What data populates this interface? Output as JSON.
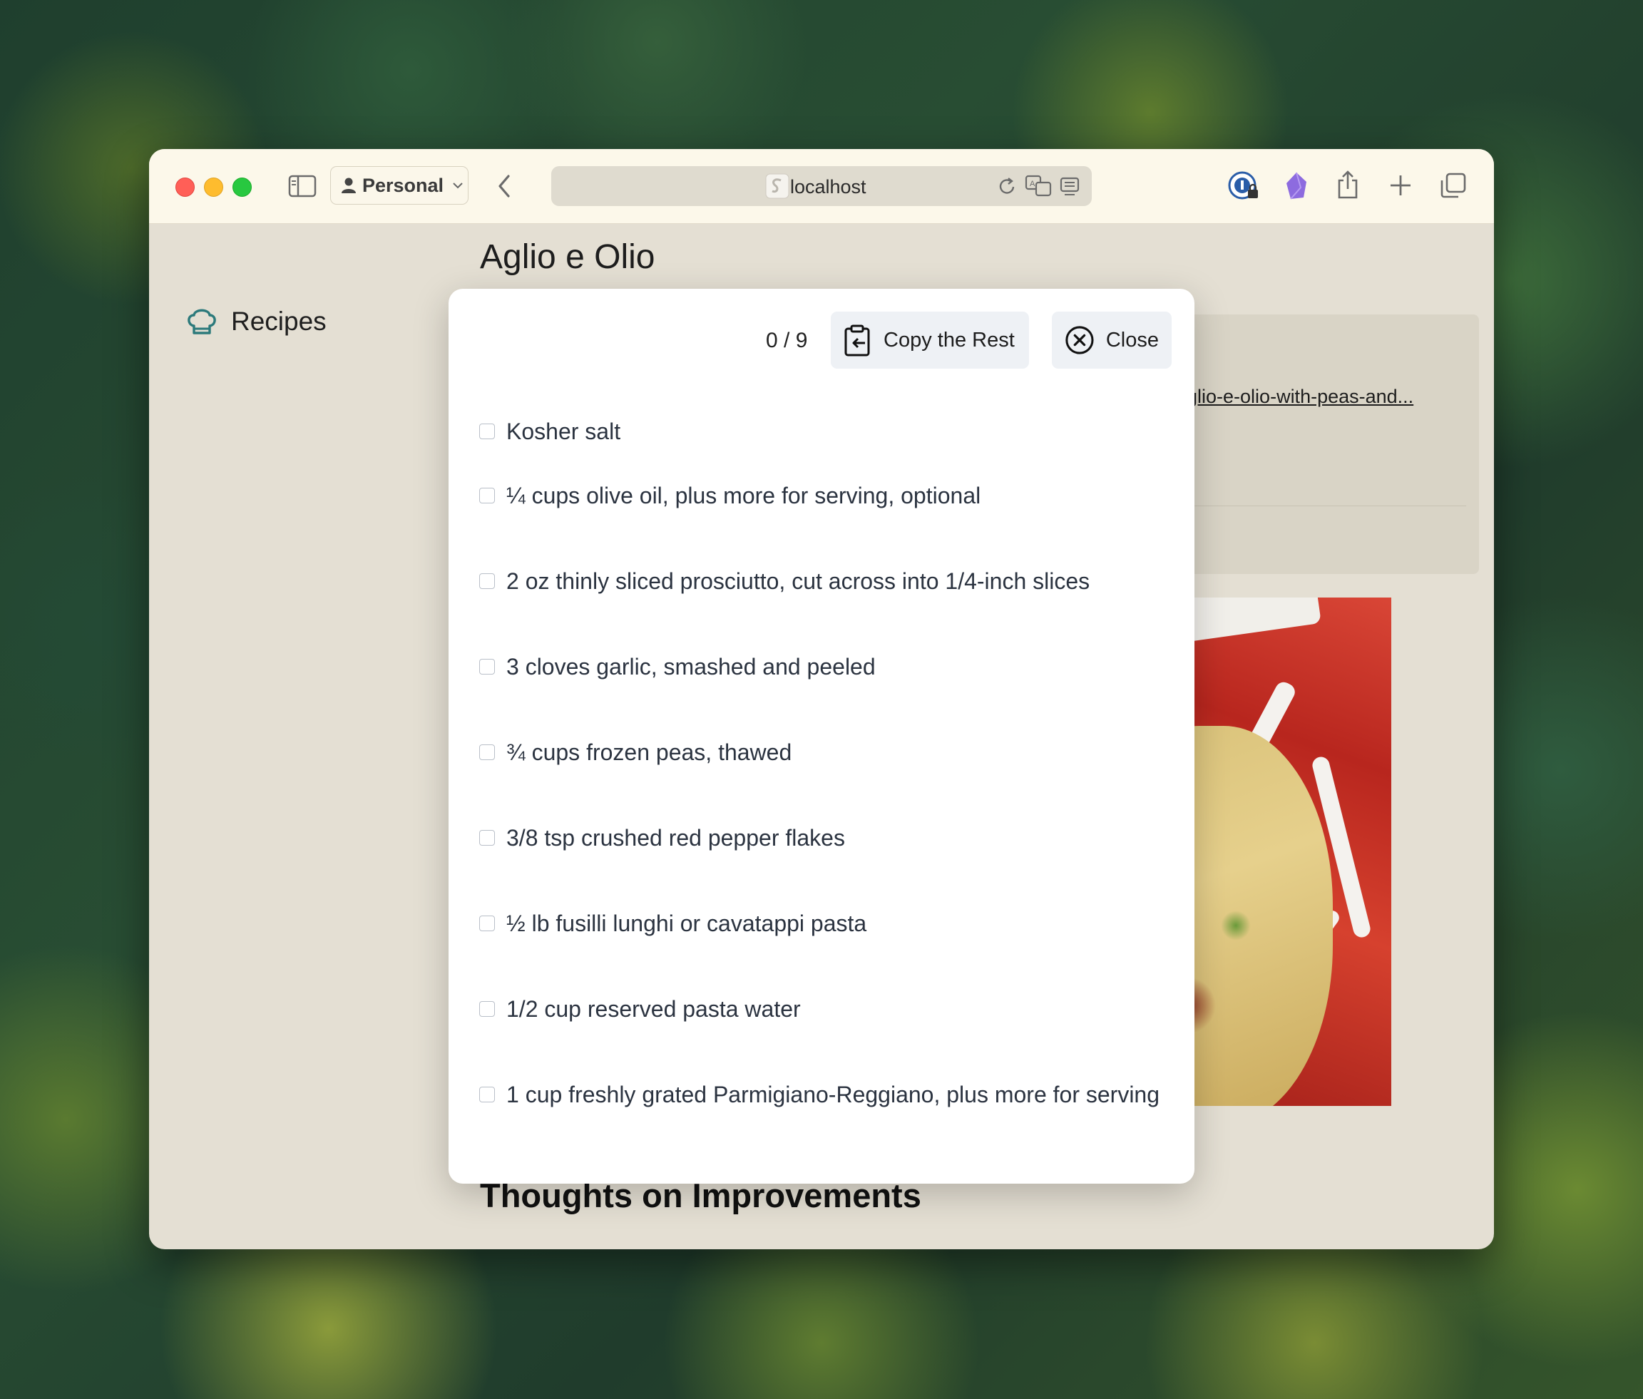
{
  "browser": {
    "profile_label": "Personal",
    "url": "localhost"
  },
  "page": {
    "title": "Aglio e Olio",
    "nav_label": "Recipes",
    "source_link": "aglio-e-olio-with-peas-and...",
    "bottom_heading": "Thoughts on Improvements"
  },
  "modal": {
    "counter": "0 / 9",
    "copy_label": "Copy the Rest",
    "close_label": "Close",
    "ingredients": [
      "Kosher salt",
      "¼ cups olive oil, plus more for serving, optional",
      "2 oz thinly sliced prosciutto, cut across into 1/4-inch slices",
      "3 cloves garlic, smashed and peeled",
      "¾ cups frozen peas, thawed",
      "3/8 tsp crushed red pepper flakes",
      "½ lb fusilli lunghi or cavatappi pasta",
      "1/2 cup reserved pasta water",
      "1 cup freshly grated Parmigiano-Reggiano, plus more for serving"
    ]
  },
  "colors": {
    "traffic_close": "#ff5f57",
    "traffic_min": "#febc2e",
    "traffic_max": "#28c840",
    "nav_icon": "#2c7a7b",
    "page_bg": "#e4dfd3",
    "toolbar_bg": "#fcf8ea"
  }
}
